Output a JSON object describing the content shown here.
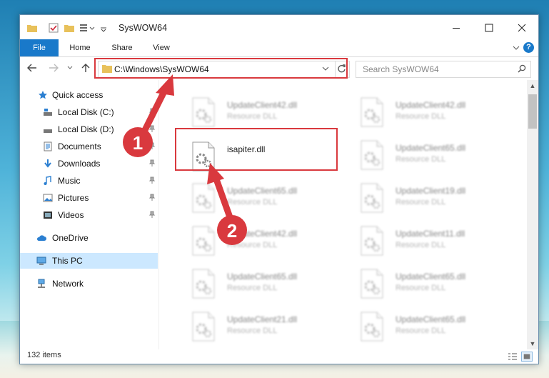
{
  "window": {
    "title": "SysWOW64"
  },
  "ribbon": {
    "tabs": [
      "File",
      "Home",
      "Share",
      "View"
    ],
    "help": "?"
  },
  "nav": {
    "address": "C:\\Windows\\SysWOW64",
    "search_placeholder": "Search SysWOW64"
  },
  "sidebar": {
    "items": [
      {
        "label": "Quick access"
      },
      {
        "label": "Local Disk (C:)"
      },
      {
        "label": "Local Disk (D:)"
      },
      {
        "label": "Documents"
      },
      {
        "label": "Downloads"
      },
      {
        "label": "Music"
      },
      {
        "label": "Pictures"
      },
      {
        "label": "Videos"
      },
      {
        "label": "OneDrive"
      },
      {
        "label": "This PC"
      },
      {
        "label": "Network"
      }
    ]
  },
  "files": {
    "highlighted": {
      "name": "isapiter.dll"
    },
    "left_column": [
      {
        "name": "UpdateClient42.dll",
        "type": "Resource DLL"
      },
      {
        "name": "UpdateClient65.dll",
        "type": "Resource DLL"
      },
      {
        "name": "UpdateClient42.dll",
        "type": "Resource DLL"
      },
      {
        "name": "UpdateClient65.dll",
        "type": "Resource DLL"
      },
      {
        "name": "UpdateClient21.dll",
        "type": "Resource DLL"
      }
    ],
    "right_column": [
      {
        "name": "UpdateClient42.dll",
        "type": "Resource DLL"
      },
      {
        "name": "UpdateClient65.dll",
        "type": "Resource DLL"
      },
      {
        "name": "UpdateClient19.dll",
        "type": "Resource DLL"
      },
      {
        "name": "UpdateClient11.dll",
        "type": "Resource DLL"
      },
      {
        "name": "UpdateClient65.dll",
        "type": "Resource DLL"
      },
      {
        "name": "UpdateClient65.dll",
        "type": "Resource DLL"
      }
    ]
  },
  "status": {
    "item_count": "132 items"
  },
  "annotations": {
    "step1": "1",
    "step2": "2"
  },
  "colors": {
    "accent": "#1979ca",
    "highlight": "#d9393e",
    "selected": "#cce8ff"
  }
}
